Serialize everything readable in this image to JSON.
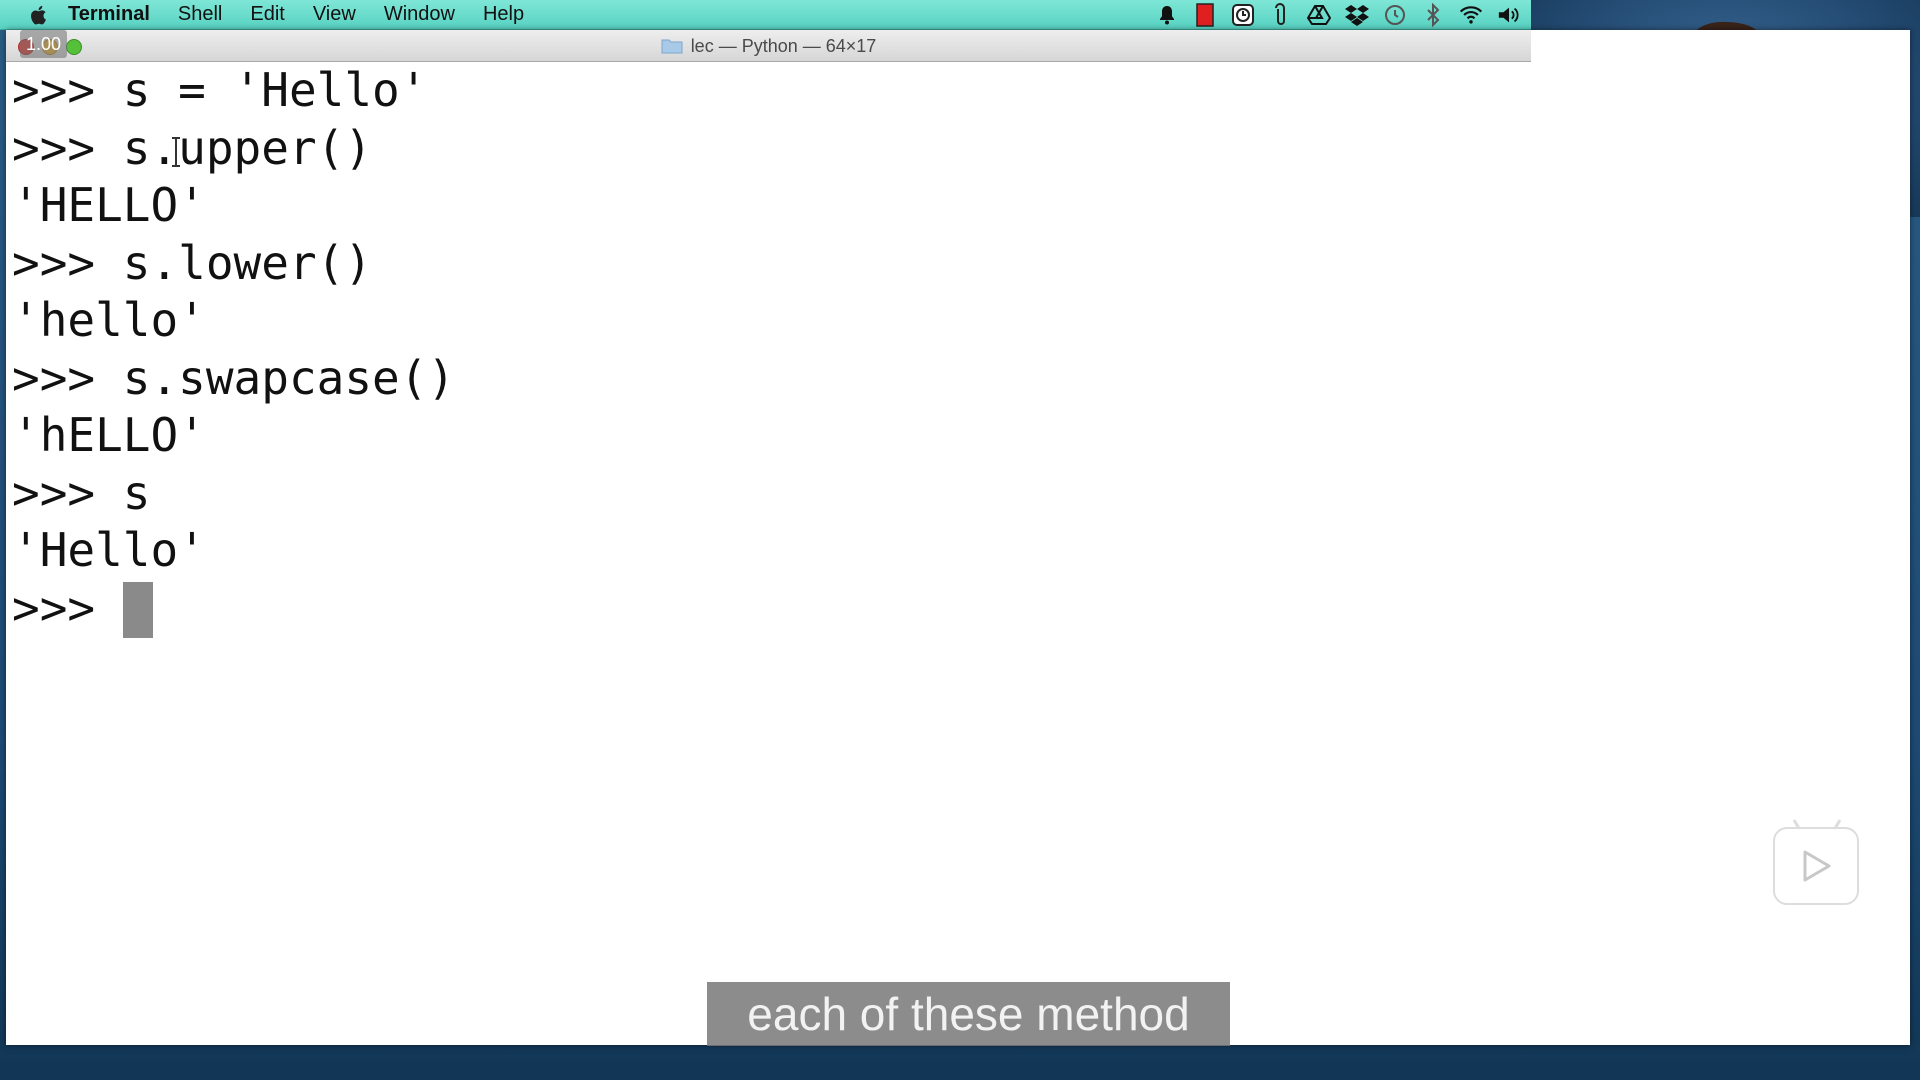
{
  "menubar": {
    "app_name": "Terminal",
    "items": [
      "Shell",
      "Edit",
      "View",
      "Window",
      "Help"
    ],
    "status_icons": [
      "bell-icon",
      "flag-icon",
      "clock-app-icon",
      "paperclip-icon",
      "drive-icon",
      "dropbox-icon",
      "time-machine-icon",
      "bluetooth-icon",
      "wifi-icon",
      "volume-icon"
    ]
  },
  "window": {
    "title": "lec — Python — 64×17",
    "speed_badge": "1.00"
  },
  "terminal": {
    "lines": [
      ">>> s = 'Hello'",
      ">>> s.upper()",
      "'HELLO'",
      ">>> s.lower()",
      "'hello'",
      ">>> s.swapcase()",
      "'hELLO'",
      ">>> s",
      "'Hello'"
    ],
    "prompt": ">>> "
  },
  "subtitle": "each of these method",
  "colors": {
    "menubar": "#58d3c3",
    "terminal_bg": "#ffffff",
    "terminal_text": "#111111",
    "cursor": "#8a8a8a"
  }
}
